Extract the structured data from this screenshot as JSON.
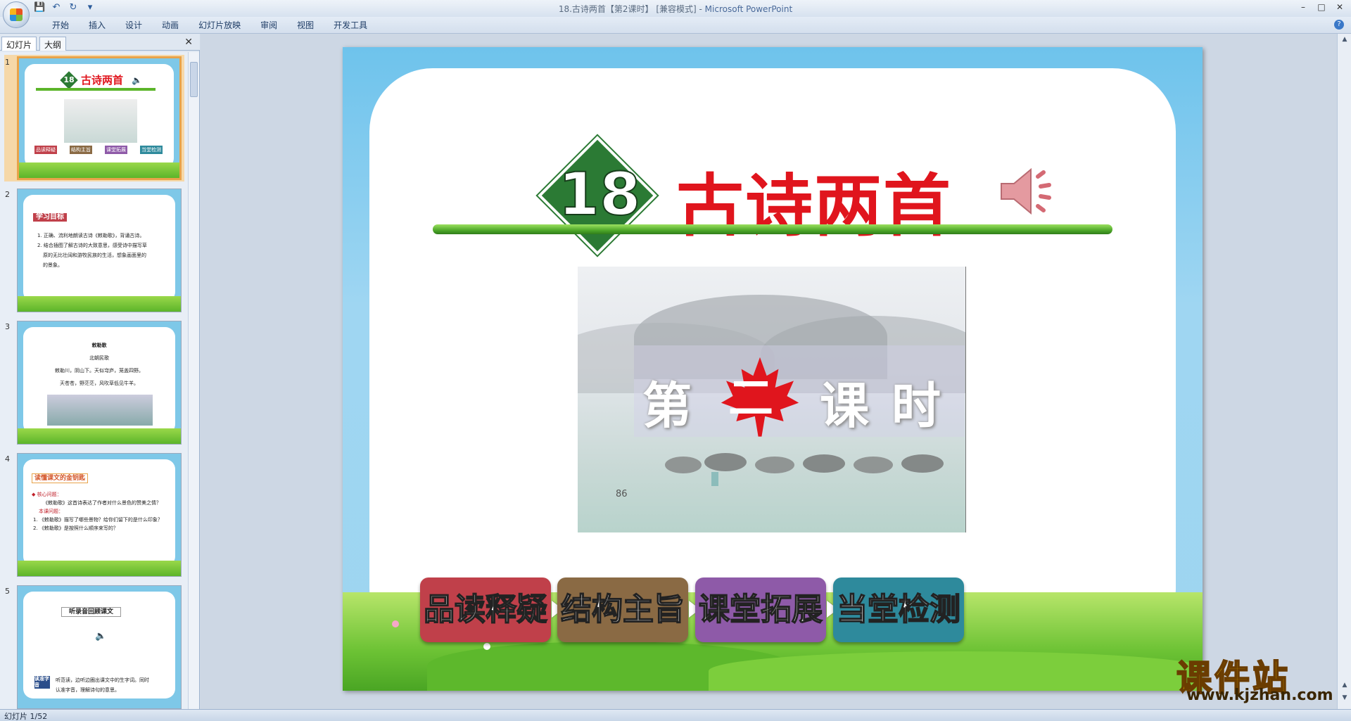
{
  "window": {
    "title": "18.古诗两首【第2课时】 [兼容模式] - ",
    "app_name": "Microsoft PowerPoint"
  },
  "ribbon": {
    "tabs": [
      "开始",
      "插入",
      "设计",
      "动画",
      "幻灯片放映",
      "审阅",
      "视图",
      "开发工具"
    ]
  },
  "left_pane": {
    "tab_slides": "幻灯片",
    "tab_outline": "大纲",
    "close_glyph": "✕",
    "thumbs": [
      {
        "number": "1",
        "title": "古诗两首",
        "badge": "18",
        "buttons": [
          "品读释疑",
          "结构主旨",
          "课堂拓展",
          "当堂检测"
        ]
      },
      {
        "number": "2",
        "heading": "学习目标",
        "lines": [
          "1. 正确、流利地朗读古诗《敕勒歌》，背诵古诗。",
          "2. 结合插图了解古诗的大致意思，感受诗中描写草",
          "原的无比壮阔和游牧民族的生活，想象画面里的",
          "的景象。"
        ]
      },
      {
        "number": "3",
        "heading": "敕勒歌",
        "sub": "北朝民歌",
        "lines": [
          "敕勒川，阴山下。天似穹庐，笼盖四野。",
          "天苍苍，野茫茫，风吹草低见牛羊。"
        ]
      },
      {
        "number": "4",
        "heading": "读懂课文的金钥匙",
        "lines": [
          "◆ 核心问题：",
          "《敕勒歌》这首诗表达了作者对什么景色的赞美之情？",
          "本课问题：",
          "1. 《敕勒歌》描写了哪些景物？给你们留下的是什么印象？",
          "2. 《敕勒歌》是按照什么顺序来写的？"
        ]
      },
      {
        "number": "5",
        "heading": "听录音回顾课文",
        "tag": "读准字音",
        "lines": [
          "听范读，边听边圈出课文中的生字词。同时",
          "认准字音，理解诗句的意思。"
        ]
      }
    ]
  },
  "slide": {
    "lesson_number": "18",
    "title": "古诗两首",
    "picture": {
      "char1": "第",
      "char2": "二",
      "char3": "课",
      "char4": "时",
      "page_number": "86"
    },
    "nav_buttons": [
      {
        "label": "品读释疑",
        "color": "#c0404a"
      },
      {
        "label": "结构主旨",
        "color": "#8a6a44"
      },
      {
        "label": "课堂拓展",
        "color": "#8e5aa8"
      },
      {
        "label": "当堂检测",
        "color": "#2e8a9c"
      }
    ],
    "arrow_glyph": "▶"
  },
  "watermark": {
    "brand": "课件站",
    "url": "www.kjzhan.com"
  },
  "status_bar": {
    "slide_indicator": "幻灯片 1/52"
  },
  "colors": {
    "title_red": "#e0151d",
    "badge_green": "#2b7a34",
    "selected_border": "#e8a34a"
  }
}
